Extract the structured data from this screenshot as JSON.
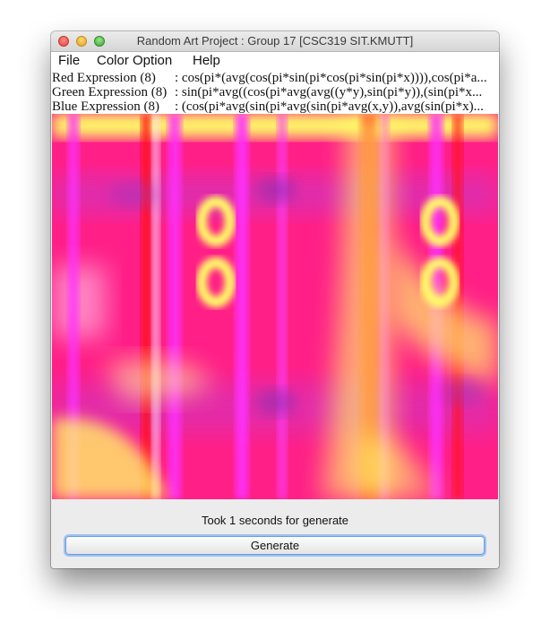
{
  "window": {
    "title": "Random Art Project : Group 17 [CSC319 SIT.KMUTT]"
  },
  "menubar": {
    "items": [
      "File",
      "Color Option",
      "Help"
    ]
  },
  "expressions": [
    {
      "label": "Red Expression (8)",
      "value": ": cos(pi*(avg(cos(pi*sin(pi*cos(pi*sin(pi*x)))),cos(pi*a..."
    },
    {
      "label": "Green Expression (8)",
      "value": ": sin(pi*avg((cos(pi*avg(avg((y*y),sin(pi*y)),(sin(pi*x..."
    },
    {
      "label": "Blue Expression (8)",
      "value": ": (cos(pi*avg(sin(pi*avg(sin(pi*avg(x,y)),avg(sin(pi*x)..."
    }
  ],
  "status": {
    "text": "Took 1 seconds for generate"
  },
  "actions": {
    "generate_label": "Generate"
  },
  "colors": {
    "art_base": "#ff1f87",
    "art_yellow": "#ffff66",
    "art_magenta": "#ff22ff",
    "art_red": "#ff1010",
    "art_purple": "#b040c0",
    "button_focus": "#6b9be0"
  }
}
